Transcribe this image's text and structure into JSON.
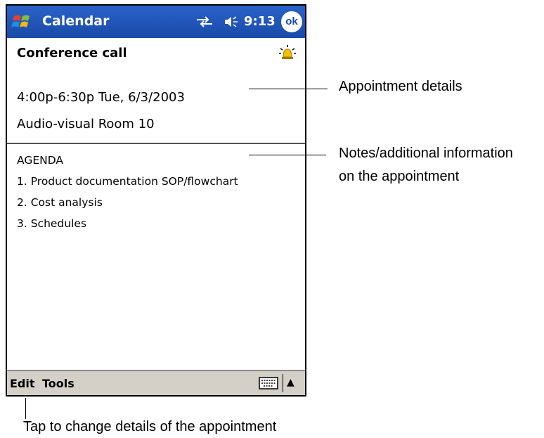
{
  "titlebar": {
    "app_title": "Calendar",
    "clock": "9:13",
    "ok_label": "ok",
    "start_icon": "windows-flag-icon",
    "connectivity_icon": "connectivity-icon",
    "volume_icon": "speaker-icon"
  },
  "appointment": {
    "subject": "Conference call",
    "alarm_icon": "alarm-bell-icon",
    "time": "4:00p-6:30p Tue, 6/3/2003",
    "location": "Audio-visual Room 10"
  },
  "notes": {
    "lines": [
      "AGENDA",
      "1. Product documentation SOP/flowchart",
      "2. Cost analysis",
      "3. Schedules"
    ]
  },
  "menubar": {
    "edit_label": "Edit",
    "tools_label": "Tools",
    "keyboard_icon": "keyboard-icon",
    "sip_arrow": "▲"
  },
  "callouts": {
    "appointment_details": "Appointment details",
    "notes_line1": "Notes/additional information",
    "notes_line2": "on the appointment",
    "edit_hint": "Tap to change details of the appointment"
  },
  "colors": {
    "titlebar": "#1a4aa8",
    "menubar": "#d4d0c8"
  }
}
